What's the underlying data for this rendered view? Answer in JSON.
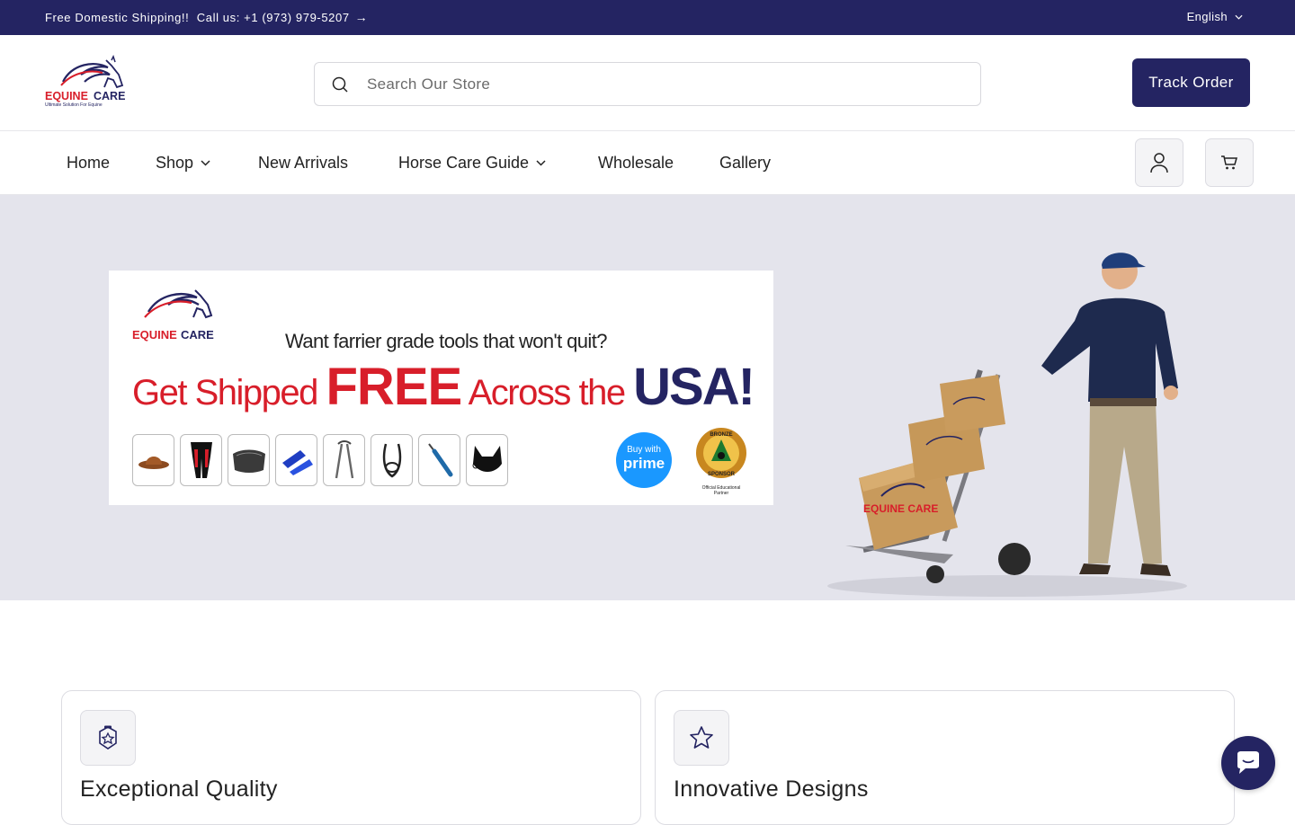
{
  "announcement": {
    "text": "Free Domestic Shipping!!  Call us: +1 (973) 979-5207",
    "arrow": "→"
  },
  "language": {
    "selected": "English"
  },
  "logo": {
    "brand_left": "EQUINE",
    "brand_right": "CARE",
    "tagline": "Ultimate Solution For Equine"
  },
  "search": {
    "placeholder": "Search Our Store"
  },
  "header": {
    "track_order_label": "Track Order"
  },
  "nav": {
    "items": [
      {
        "label": "Home",
        "has_dropdown": false
      },
      {
        "label": "Shop",
        "has_dropdown": true
      },
      {
        "label": "New Arrivals",
        "has_dropdown": false
      },
      {
        "label": "Horse Care Guide",
        "has_dropdown": true
      },
      {
        "label": "Wholesale",
        "has_dropdown": false
      },
      {
        "label": "Gallery",
        "has_dropdown": false
      }
    ],
    "icons": [
      "account-icon",
      "cart-icon"
    ]
  },
  "hero": {
    "banner": {
      "tagline": "Want farrier grade tools that won't quit?",
      "headline_part1": "Get Shipped ",
      "headline_part2": "FREE",
      "headline_part3": " Across the ",
      "headline_part4": "USA!",
      "prime_line1": "Buy with",
      "prime_line2": "prime",
      "sponsor_line1": "BRONZE",
      "sponsor_line2": "SPONSOR",
      "sponsor_caption": "Official Educational Partner",
      "products": [
        "hat-icon",
        "chaps-icon",
        "saddle-pad-icon",
        "bandage-icon",
        "hoof-nipper-icon",
        "noseband-icon",
        "hoof-pick-icon",
        "ear-bonnet-icon"
      ]
    },
    "box_label": "EQUINE CARE"
  },
  "features": [
    {
      "title": "Exceptional Quality",
      "icon": "quality-badge-icon"
    },
    {
      "title": "Innovative Designs",
      "icon": "star-icon"
    }
  ],
  "colors": {
    "brand_navy": "#242462",
    "brand_red": "#d81e2a",
    "prime_blue": "#1a98ff",
    "hero_bg": "#e4e4ec"
  }
}
